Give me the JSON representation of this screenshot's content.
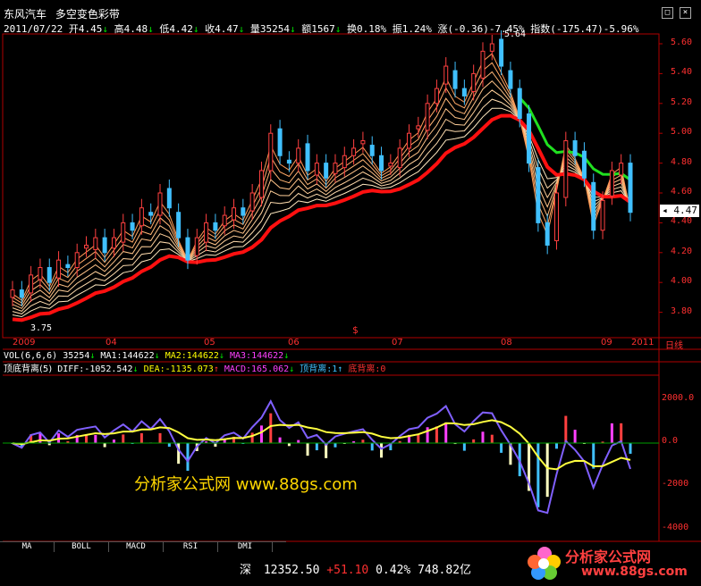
{
  "header": {
    "stock_name": "东风汽车",
    "indicator_name": "多空变色彩带",
    "date": "2011/07/22",
    "open": "开4.45",
    "high": "高4.48",
    "low": "低4.42",
    "close": "收4.47",
    "volume": "量35254",
    "amount": "额1567",
    "turnover": "换0.18%",
    "amplitude": "振1.24%",
    "change": "涨(-0.36)-7.45%",
    "index": "指数(-175.47)-5.96%"
  },
  "window_buttons": {
    "minimize": "□",
    "close": "×"
  },
  "price_axis": [
    "5.60",
    "5.40",
    "5.20",
    "5.00",
    "4.80",
    "4.60",
    "4.40",
    "4.20",
    "4.00",
    "3.80"
  ],
  "price_current": "4.47",
  "price_max_label": "5.64",
  "price_min_label": "3.75",
  "time_axis": [
    "2009",
    "04",
    "05",
    "06",
    "07",
    "08",
    "09",
    "2011",
    "日线"
  ],
  "dividend_mark": "$",
  "vol_row": {
    "label": "VOL(6,6,6)",
    "value": "35254",
    "ma1": "MA1:144622",
    "ma2": "MA2:144622",
    "ma3": "MA3:144622"
  },
  "macd_row": {
    "label": "顶底背离(5)",
    "diff": "DIFF:-1052.542",
    "dea": "DEA:-1135.073",
    "macd": "MACD:165.062",
    "top": "顶背离:1",
    "bottom": "底背离:0"
  },
  "macd_axis": [
    "2000.0",
    "0.0",
    "-2000",
    "-4000"
  ],
  "tabs": [
    "MA",
    "BOLL",
    "MACD",
    "RSI",
    "DMI"
  ],
  "ticker": {
    "market": "深",
    "index_value": "12352.50",
    "change": "+51.10",
    "percent": "0.42%",
    "amount": "748.82亿"
  },
  "watermark": "分析家公式网 www.88gs.com",
  "logo": {
    "name": "分析家公式网",
    "url": "www.88gs.com"
  },
  "chart_data": {
    "type": "candlestick",
    "title": "东风汽车 多空变色彩带",
    "ylim": [
      3.7,
      5.7
    ],
    "closes": [
      3.95,
      3.9,
      4.05,
      4.1,
      4.0,
      4.15,
      4.1,
      4.2,
      4.25,
      4.3,
      4.2,
      4.3,
      4.4,
      4.35,
      4.5,
      4.45,
      4.6,
      4.5,
      4.3,
      4.15,
      4.3,
      4.4,
      4.35,
      4.45,
      4.5,
      4.45,
      4.6,
      4.75,
      5.0,
      4.85,
      4.8,
      4.9,
      4.75,
      4.8,
      4.7,
      4.8,
      4.85,
      4.9,
      4.95,
      4.85,
      4.75,
      4.8,
      4.9,
      5.0,
      5.05,
      5.2,
      5.3,
      5.45,
      5.3,
      5.25,
      5.4,
      5.55,
      5.6,
      5.45,
      5.3,
      5.1,
      4.8,
      4.4,
      4.25,
      4.6,
      4.95,
      4.85,
      4.7,
      4.35,
      4.55,
      4.75,
      4.8,
      4.47
    ],
    "macd_ylim": [
      -4200,
      2800
    ]
  }
}
